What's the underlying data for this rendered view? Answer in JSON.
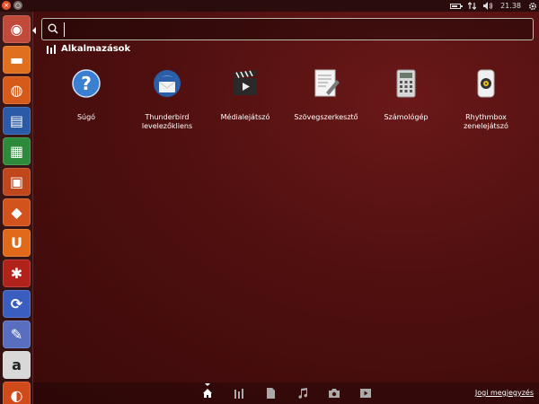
{
  "panel": {
    "clock": "21.38",
    "close_glyph": "×",
    "max_glyph": "○"
  },
  "search": {
    "placeholder": ""
  },
  "category": {
    "label": "Alkalmazások"
  },
  "apps": [
    {
      "label": "Súgó",
      "icon": "help-icon"
    },
    {
      "label": "Thunderbird levelezőkliens",
      "icon": "thunderbird-icon"
    },
    {
      "label": "Médialejátszó",
      "icon": "media-player-icon"
    },
    {
      "label": "Szövegszerkesztő",
      "icon": "text-editor-icon"
    },
    {
      "label": "Számológép",
      "icon": "calculator-icon"
    },
    {
      "label": "Rhythmbox zenelejátszó",
      "icon": "rhythmbox-icon"
    }
  ],
  "launcher": [
    {
      "name": "dash-home",
      "color": "#c24a3a",
      "glyph": "◉"
    },
    {
      "name": "home-folder",
      "color": "#e0701e",
      "glyph": "▬"
    },
    {
      "name": "firefox",
      "color": "#d65b1a",
      "glyph": "◍"
    },
    {
      "name": "libreoffice-writer",
      "color": "#2a5aa8",
      "glyph": "▤"
    },
    {
      "name": "libreoffice-calc",
      "color": "#2d8a3a",
      "glyph": "▦"
    },
    {
      "name": "libreoffice-impress",
      "color": "#c0461c",
      "glyph": "▣"
    },
    {
      "name": "software-center",
      "color": "#d2541c",
      "glyph": "◆"
    },
    {
      "name": "ubuntu-one",
      "color": "#e06a1a",
      "glyph": "U"
    },
    {
      "name": "system-settings",
      "color": "#b0221a",
      "glyph": "✱"
    },
    {
      "name": "update-manager",
      "color": "#3a5ec0",
      "glyph": "⟳"
    },
    {
      "name": "workspace-switcher",
      "color": "#5a6ec0",
      "glyph": "✎"
    },
    {
      "name": "amazon",
      "color": "#d8d8d8",
      "glyph": "a"
    },
    {
      "name": "trash",
      "color": "#d04a1a",
      "glyph": "◐"
    }
  ],
  "lenses": [
    "home-lens",
    "applications-lens",
    "files-lens",
    "music-lens",
    "photos-lens",
    "video-lens"
  ],
  "footer": {
    "legal_label": "Jogi megjegyzés"
  }
}
